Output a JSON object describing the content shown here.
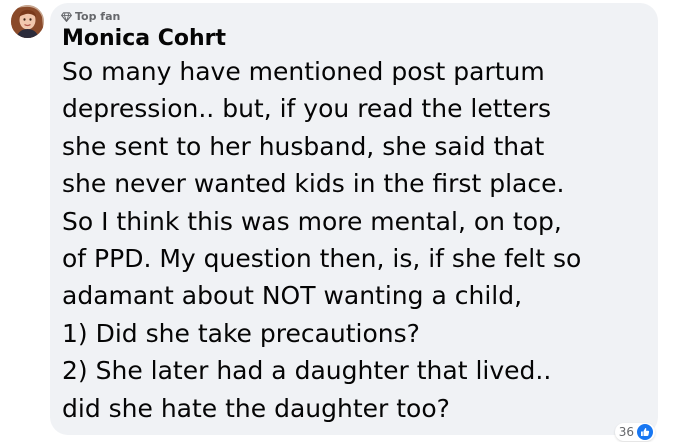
{
  "comment": {
    "badge": "Top fan",
    "author": "Monica Cohrt",
    "lines": [
      "So many have mentioned post partum",
      "depression.. but, if you read the letters",
      "she sent to her husband, she said that",
      "she never wanted kids in the first place.",
      "So I think this was more mental, on top,",
      "of PPD. My question then, is, if she felt so",
      "adamant about NOT wanting a child,",
      "1) Did she take precautions?",
      "2) She later had a daughter that lived..",
      "did she hate the daughter too?"
    ],
    "reaction_count": "36",
    "reaction_icon": "like-icon"
  },
  "colors": {
    "bubble": "#f0f2f5",
    "text": "#050505",
    "muted": "#65676b",
    "like": "#1877f2"
  }
}
